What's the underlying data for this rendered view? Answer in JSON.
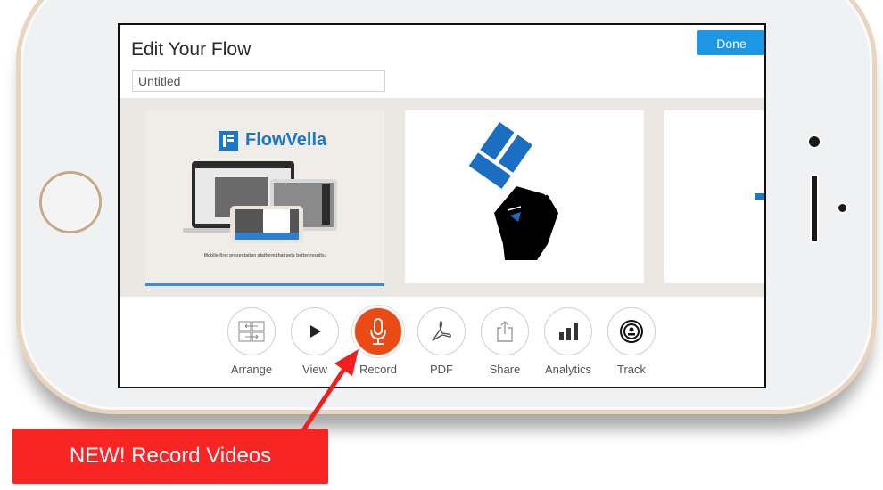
{
  "device": {
    "type": "iPhone landscape",
    "frame_color": "#e9d4bd"
  },
  "header": {
    "title": "Edit Your Flow",
    "flow_name_value": "Untitled",
    "done_label": "Done"
  },
  "slides": [
    {
      "brand": "FlowVella",
      "tagline": "Mobile-first presentation platform that gets better results.",
      "selected": true
    },
    {
      "image": "fist-holding-flowvella-logo"
    },
    {
      "image": "partial-slide"
    }
  ],
  "toolbar": {
    "items": [
      {
        "label": "Arrange",
        "icon": "arrange-icon"
      },
      {
        "label": "View",
        "icon": "play-icon"
      },
      {
        "label": "Record",
        "icon": "microphone-icon",
        "active": true
      },
      {
        "label": "PDF",
        "icon": "pdf-icon"
      },
      {
        "label": "Share",
        "icon": "share-icon"
      },
      {
        "label": "Analytics",
        "icon": "bar-chart-icon"
      },
      {
        "label": "Track",
        "icon": "track-icon"
      }
    ]
  },
  "callout": {
    "text": "NEW! Record Videos",
    "color": "#f92424"
  },
  "colors": {
    "accent": "#1d97e4",
    "record": "#ea4a14",
    "brand_blue": "#1b78c8"
  }
}
